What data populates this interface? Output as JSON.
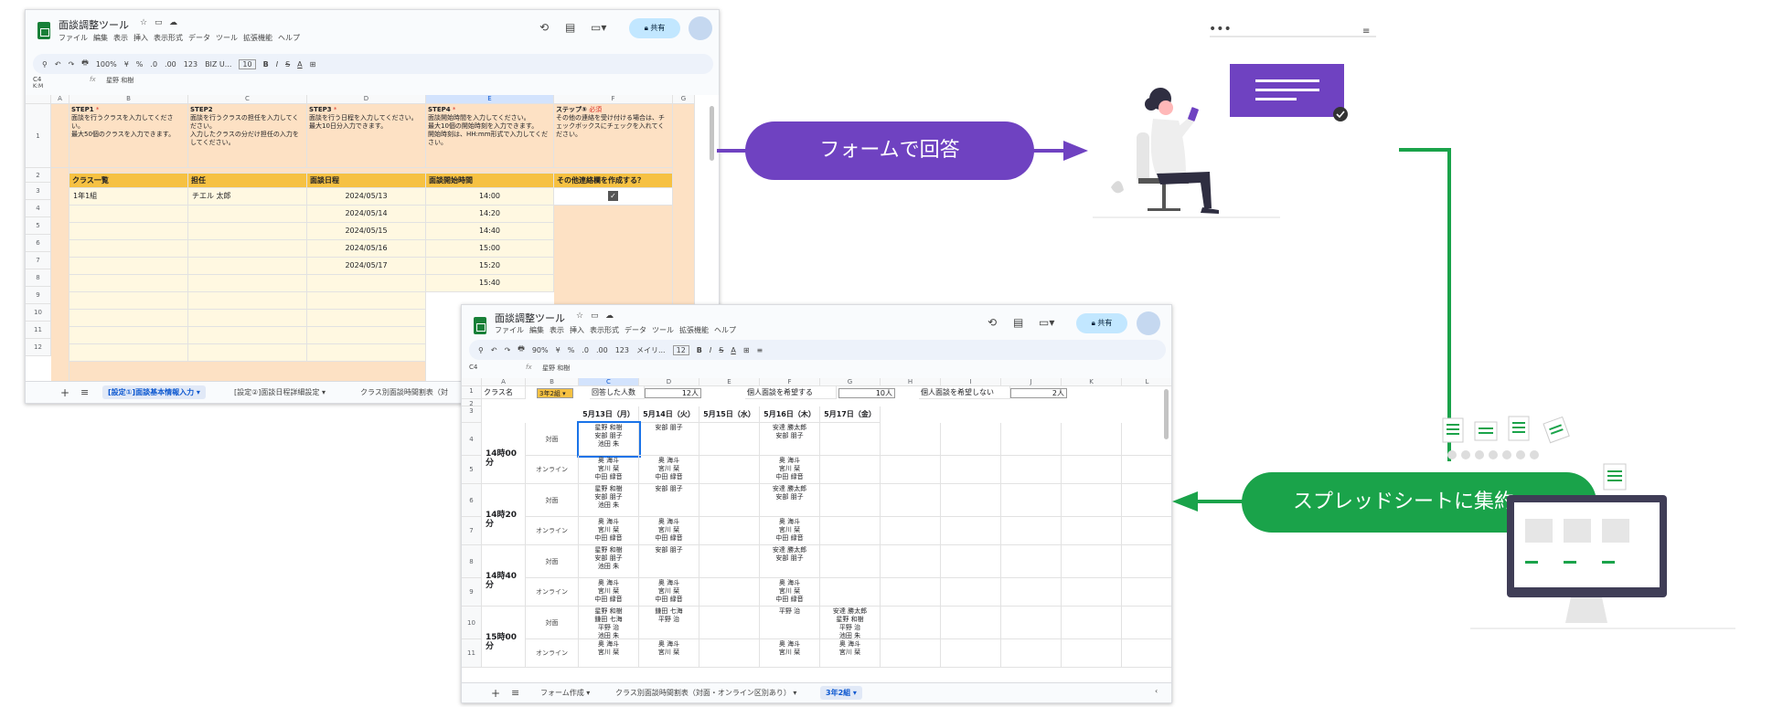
{
  "colors": {
    "purple": "#6f42c1",
    "green": "#1aa34a",
    "orange_bg": "#fde1c4",
    "header_yellow": "#f6c142"
  },
  "app": {
    "title": "面談調整ツール",
    "menu": [
      "ファイル",
      "編集",
      "表示",
      "挿入",
      "表示形式",
      "データ",
      "ツール",
      "拡張機能",
      "ヘルプ"
    ],
    "share": "共有"
  },
  "sheet1": {
    "zoom": "100%",
    "font": "BIZ U...",
    "font_size": "10",
    "cell_ref": "C4",
    "cell_ref_sub": "K:M",
    "fx_value": "星野 和樹",
    "toolbar": [
      "↶",
      "↷",
      "🖶",
      "¥",
      "%",
      ".0",
      ".00",
      "123"
    ],
    "cols": [
      "A",
      "B",
      "C",
      "D",
      "E",
      "F",
      "G"
    ],
    "rows": [
      "1",
      "2",
      "3",
      "4",
      "5",
      "6",
      "7",
      "8",
      "9",
      "10",
      "11",
      "12"
    ],
    "steps": [
      {
        "title": "STEP1",
        "req": "*",
        "text": "面談を行うクラスを入力してください。\n最大50個のクラスを入力できます。"
      },
      {
        "title": "STEP2",
        "req": "",
        "text": "面談を行うクラスの担任を入力してください。\n入力したクラスの分だけ担任の入力をしてください。"
      },
      {
        "title": "STEP3",
        "req": "*",
        "text": "面談を行う日程を入力してください。\n最大10日分入力できます。"
      },
      {
        "title": "STEP4",
        "req": "*",
        "text": "面談開始時間を入力してください。\n最大10個の開始時刻を入力できます。\n開始時刻は、HH:mm形式で入力してください。"
      },
      {
        "title": "ステップ⑤",
        "req": "必須",
        "text": "その他の連絡を受け付ける場合は、チェックボックスにチェックを入れてください。"
      }
    ],
    "headers": [
      "クラス一覧",
      "担任",
      "面談日程",
      "面談開始時間",
      "その他連絡欄を作成する？"
    ],
    "class": "1年1組",
    "teacher": "チエル 太郎",
    "dates": [
      "2024/05/13",
      "2024/05/14",
      "2024/05/15",
      "2024/05/16",
      "2024/05/17"
    ],
    "times": [
      "14:00",
      "14:20",
      "14:40",
      "15:00",
      "15:20",
      "15:40"
    ],
    "tabs": [
      "[設定①]面談基本情報入力",
      "[設定②]面談日程詳細設定",
      "クラス別面談時間割表（対"
    ]
  },
  "sheet2": {
    "zoom": "90%",
    "font": "メイリ...",
    "font_size": "12",
    "cell_ref": "C4",
    "fx_value": "星野 和樹",
    "cols": [
      "A",
      "B",
      "C",
      "D",
      "E",
      "F",
      "G",
      "H",
      "I",
      "J",
      "K",
      "L"
    ],
    "row1": {
      "label": "クラス名",
      "class": "3年2組",
      "answered_label": "回答した人数",
      "answered": "12人",
      "want_label": "個人面談を希望する",
      "want": "10人",
      "nowant_label": "個人面談を希望しない",
      "nowant": "2人"
    },
    "days": [
      "5月13日（月）",
      "5月14日（火）",
      "5月15日（水）",
      "5月16日（木）",
      "5月17日（金）"
    ],
    "modes": [
      "対面",
      "オンライン"
    ],
    "slots": [
      {
        "time": "14時00分",
        "rows": [
          [
            [
              "星野 和樹",
              "安部 朋子",
              "池田 朱"
            ],
            [
              "安部 朋子"
            ],
            [],
            [
              "安達 勝太郎",
              "安部 朋子"
            ],
            []
          ],
          [
            [
              "奥 海斗",
              "宮川 栞",
              "中田 緑音"
            ],
            [
              "奥 海斗",
              "宮川 栞",
              "中田 緑音"
            ],
            [],
            [
              "奥 海斗",
              "宮川 栞",
              "中田 緑音"
            ],
            []
          ]
        ]
      },
      {
        "time": "14時20分",
        "rows": [
          [
            [
              "星野 和樹",
              "安部 朋子",
              "池田 朱"
            ],
            [
              "安部 朋子"
            ],
            [],
            [
              "安達 勝太郎",
              "安部 朋子"
            ],
            []
          ],
          [
            [
              "奥 海斗",
              "宮川 栞",
              "中田 緑音"
            ],
            [
              "奥 海斗",
              "宮川 栞",
              "中田 緑音"
            ],
            [],
            [
              "奥 海斗",
              "宮川 栞",
              "中田 緑音"
            ],
            []
          ]
        ]
      },
      {
        "time": "14時40分",
        "rows": [
          [
            [
              "星野 和樹",
              "安部 朋子",
              "池田 朱"
            ],
            [
              "安部 朋子"
            ],
            [],
            [
              "安達 勝太郎",
              "安部 朋子"
            ],
            []
          ],
          [
            [
              "奥 海斗",
              "宮川 栞",
              "中田 緑音"
            ],
            [
              "奥 海斗",
              "宮川 栞",
              "中田 緑音"
            ],
            [],
            [
              "奥 海斗",
              "宮川 栞",
              "中田 緑音"
            ],
            []
          ]
        ]
      },
      {
        "time": "15時00分",
        "rows": [
          [
            [
              "星野 和樹",
              "鎌田 七海",
              "平野 治",
              "池田 朱"
            ],
            [
              "鎌田 七海",
              "平野 治"
            ],
            [],
            [
              "平野 治"
            ],
            [
              "安達 勝太郎",
              "星野 和樹",
              "平野 治",
              "池田 朱"
            ]
          ],
          [
            [
              "奥 海斗",
              "宮川 栞"
            ],
            [
              "奥 海斗",
              "宮川 栞"
            ],
            [],
            [
              "奥 海斗",
              "宮川 栞"
            ],
            [
              "奥 海斗",
              "宮川 栞"
            ]
          ]
        ]
      }
    ],
    "tabs": [
      "フォーム作成",
      "クラス別面談時間割表（対面・オンライン区別あり）",
      "3年2組"
    ]
  },
  "flow": {
    "form_label": "フォームで回答",
    "sheet_label": "スプレッドシートに集約"
  }
}
